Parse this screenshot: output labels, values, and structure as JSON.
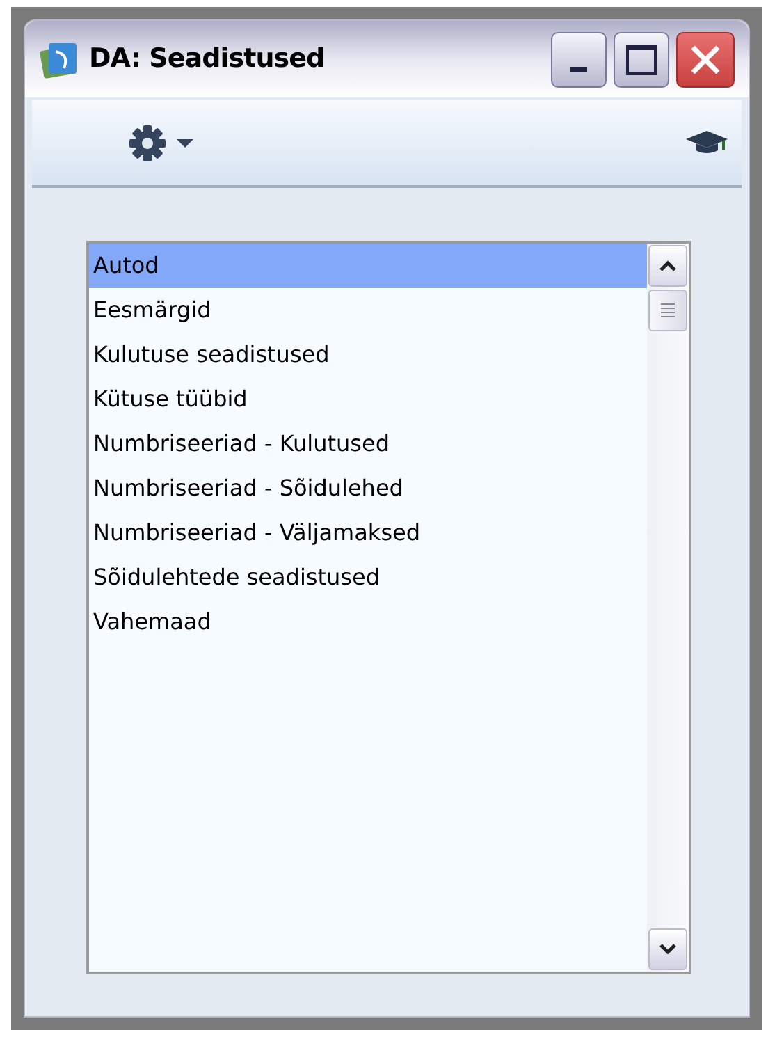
{
  "window": {
    "title": "DA: Seadistused"
  },
  "list": {
    "items": [
      {
        "label": "Autod",
        "selected": true
      },
      {
        "label": "Eesmärgid",
        "selected": false
      },
      {
        "label": "Kulutuse seadistused",
        "selected": false
      },
      {
        "label": "Kütuse tüübid",
        "selected": false
      },
      {
        "label": "Numbriseeriad - Kulutused",
        "selected": false
      },
      {
        "label": "Numbriseeriad - Sõidulehed",
        "selected": false
      },
      {
        "label": "Numbriseeriad - Väljamaksed",
        "selected": false
      },
      {
        "label": "Sõidulehtede seadistused",
        "selected": false
      },
      {
        "label": "Vahemaad",
        "selected": false
      }
    ]
  }
}
